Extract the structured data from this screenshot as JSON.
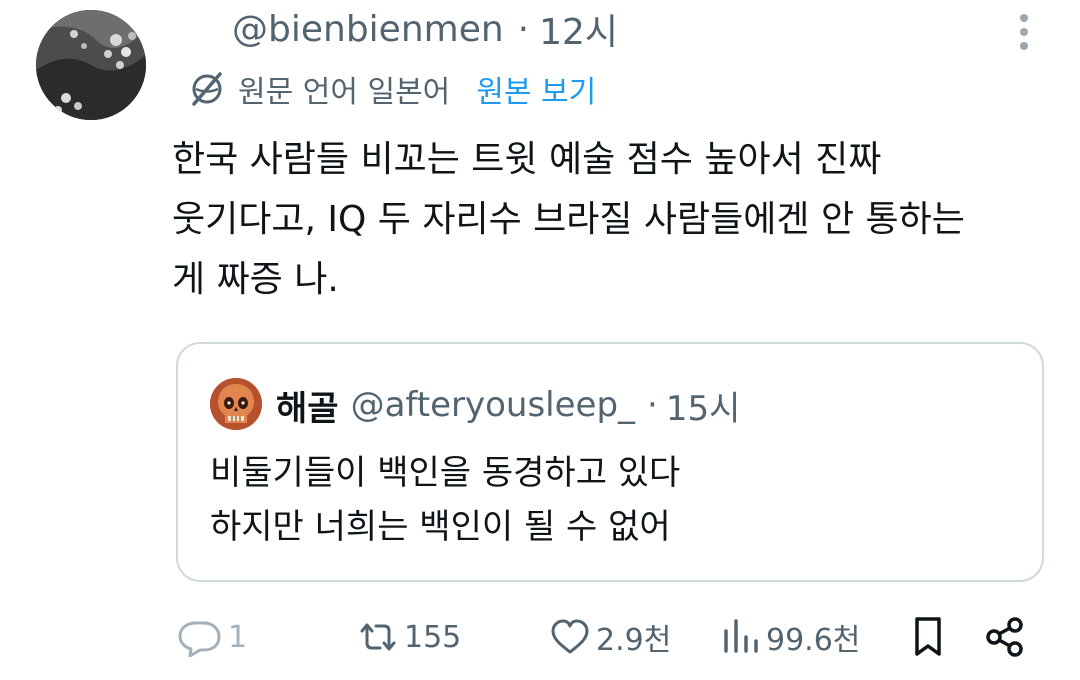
{
  "tweet": {
    "handle": "@bienbienmen",
    "separator": "·",
    "time": "12시",
    "translation": {
      "language_note": "원문 언어 일본어",
      "show_original": "원본 보기"
    },
    "text_lines": [
      "한국 사람들 비꼬는 트윗 예술 점수 높아서 진짜",
      "웃기다고, IQ 두 자리수 브라질 사람들에겐 안 통하는",
      "게 짜증 나."
    ],
    "avatar_icon": "avatar-image",
    "more_icon": "more-dots-icon"
  },
  "quote": {
    "name": "해골",
    "handle": "@afteryousleep_",
    "separator": "·",
    "time": "15시",
    "avatar_icon": "skull-avatar",
    "text_lines": [
      "비둘기들이 백인을 동경하고 있다",
      "하지만 너희는 백인이 될 수 없어"
    ]
  },
  "actions": {
    "reply_count": "1",
    "retweet_count": "155",
    "like_count": "2.9천",
    "views_count": "99.6천",
    "icons": [
      "reply-icon",
      "retweet-icon",
      "like-icon",
      "views-icon",
      "bookmark-icon",
      "share-icon"
    ]
  },
  "colors": {
    "text": "#0f1419",
    "secondary": "#536471",
    "link": "#1d9bf0",
    "border": "#cfd9de"
  }
}
